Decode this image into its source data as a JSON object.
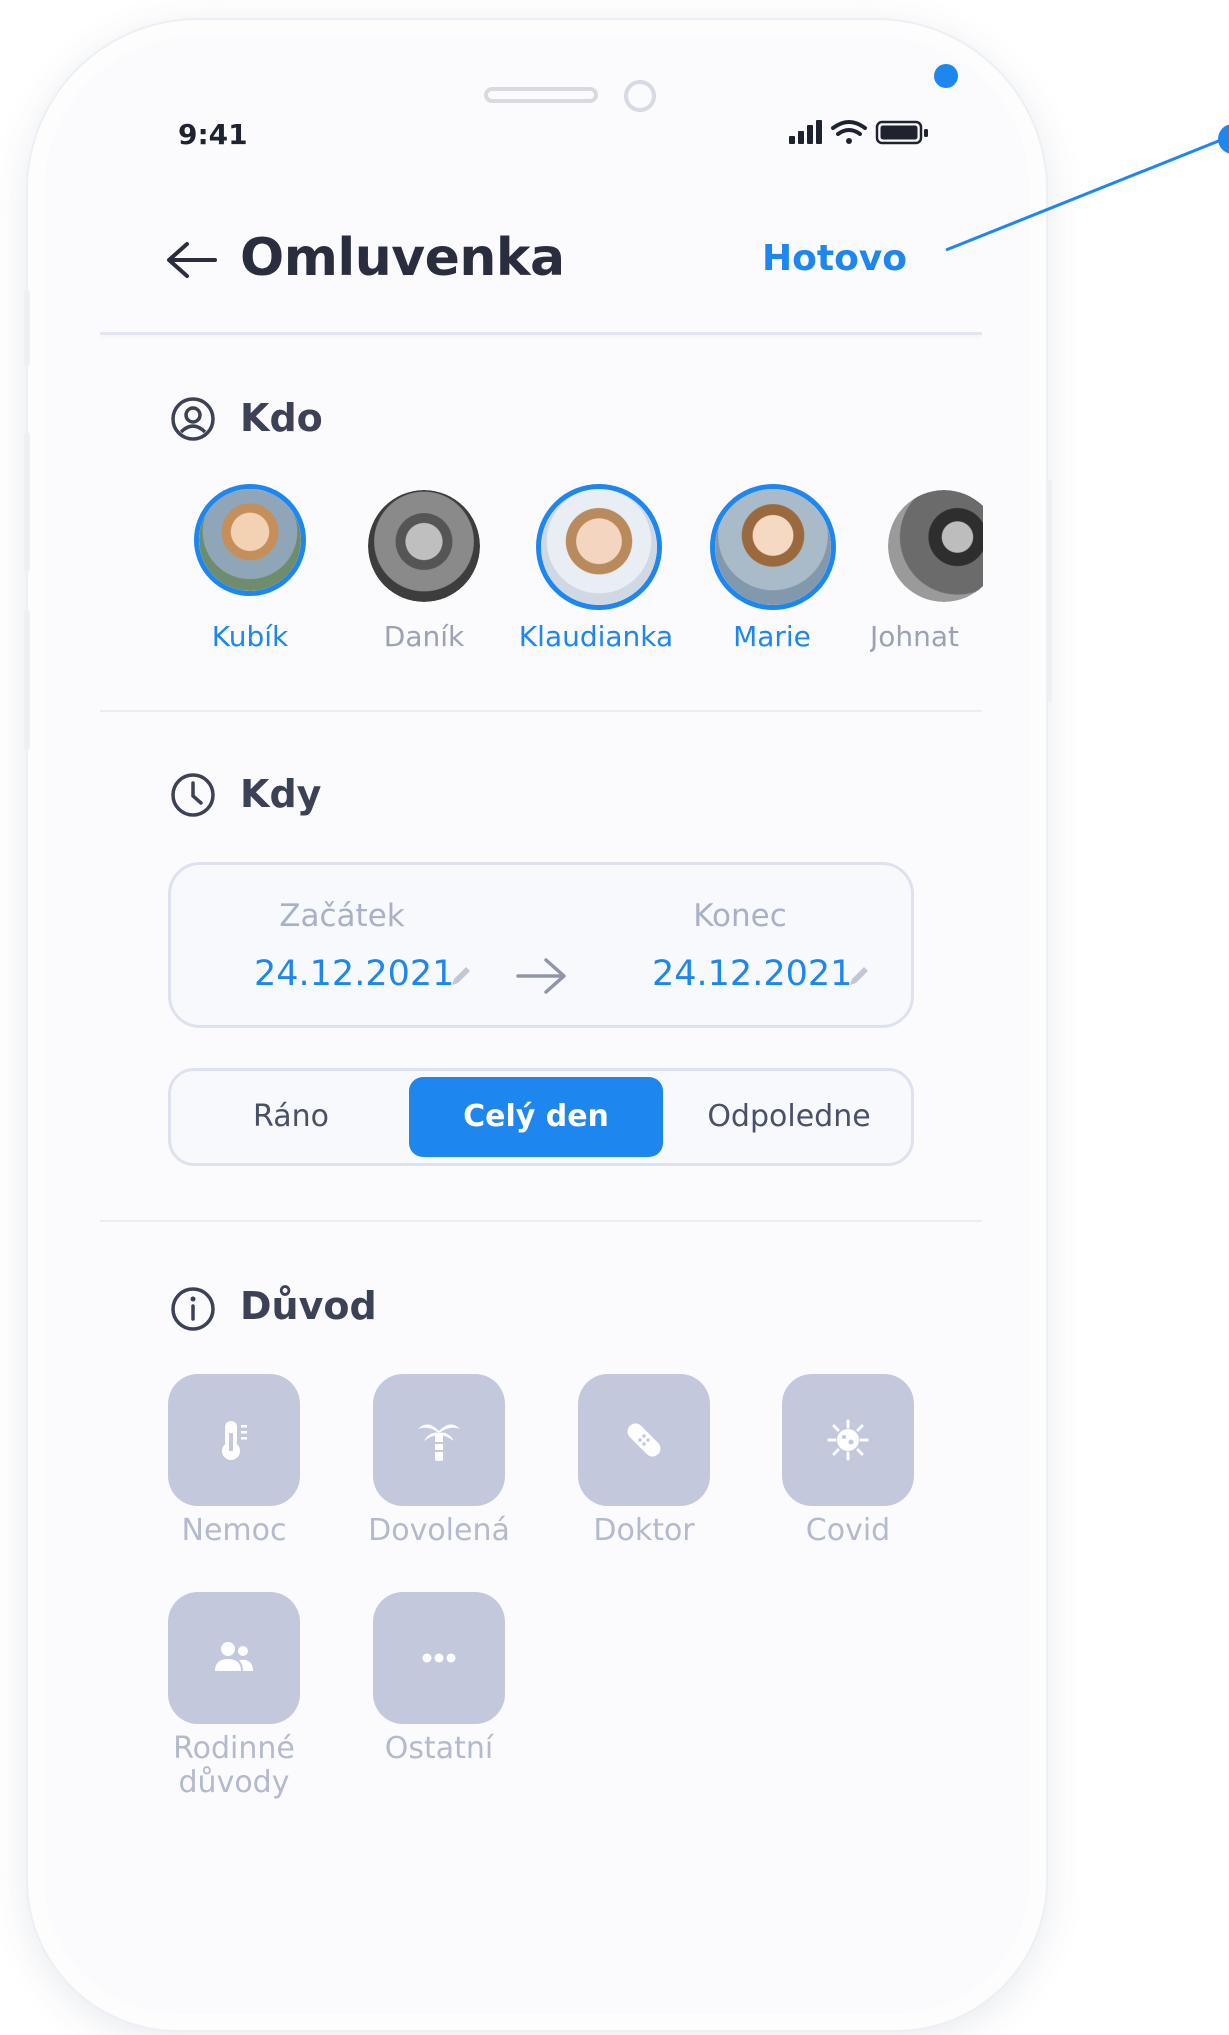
{
  "status_bar": {
    "time": "9:41"
  },
  "header": {
    "title": "Omluvenka",
    "done_label": "Hotovo"
  },
  "who": {
    "title": "Kdo",
    "children": [
      {
        "name": "Kubík",
        "selected": true
      },
      {
        "name": "Daník",
        "selected": false
      },
      {
        "name": "Klaudianka",
        "selected": true
      },
      {
        "name": "Marie",
        "selected": true
      },
      {
        "name": "Johnat",
        "selected": false
      }
    ]
  },
  "when": {
    "title": "Kdy",
    "start_label": "Začátek",
    "start_date": "24.12.2021",
    "end_label": "Konec",
    "end_date": "24.12.2021",
    "day_parts": [
      {
        "label": "Ráno",
        "active": false
      },
      {
        "label": "Celý den",
        "active": true
      },
      {
        "label": "Odpoledne",
        "active": false
      }
    ]
  },
  "reason": {
    "title": "Důvod",
    "items": [
      {
        "label": "Nemoc",
        "icon": "thermometer-icon"
      },
      {
        "label": "Dovolená",
        "icon": "palm-tree-icon"
      },
      {
        "label": "Doktor",
        "icon": "bandage-icon"
      },
      {
        "label": "Covid",
        "icon": "virus-icon"
      },
      {
        "label": "Rodinné důvody",
        "label_line1": "Rodinné",
        "label_line2": "důvody",
        "icon": "family-icon"
      },
      {
        "label": "Ostatní",
        "icon": "more-dots-icon"
      }
    ]
  },
  "colors": {
    "accent": "#1e86ef",
    "tile": "#c4c8dc",
    "text_dark": "#2a2d3e"
  }
}
